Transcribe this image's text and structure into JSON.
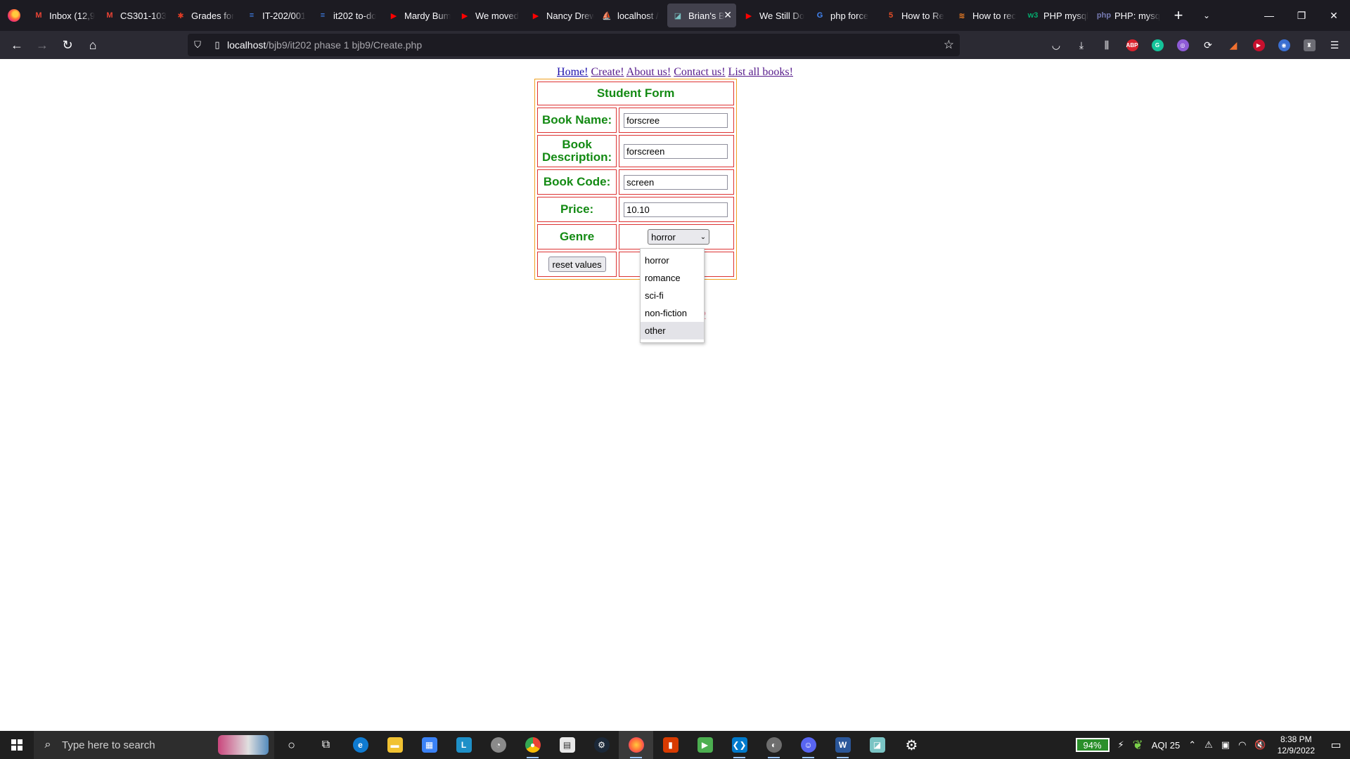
{
  "browser": {
    "tabs": [
      {
        "label": "Inbox (12,9",
        "icon": "gmail-icon",
        "glyph": "M",
        "color": "#ea4335"
      },
      {
        "label": "CS301-103",
        "icon": "gmail-icon",
        "glyph": "M",
        "color": "#ea4335"
      },
      {
        "label": "Grades for",
        "icon": "canvas-icon",
        "glyph": "✱",
        "color": "#e03b24"
      },
      {
        "label": "IT-202/001",
        "icon": "docs-icon",
        "glyph": "≡",
        "color": "#4285f4"
      },
      {
        "label": "it202 to-do",
        "icon": "docs-icon",
        "glyph": "≡",
        "color": "#4285f4"
      },
      {
        "label": "Mardy Bum",
        "icon": "youtube-icon",
        "glyph": "▶",
        "color": "#ff0000"
      },
      {
        "label": "We moved",
        "icon": "youtube-icon",
        "glyph": "▶",
        "color": "#ff0000"
      },
      {
        "label": "Nancy Drew",
        "icon": "youtube-icon",
        "glyph": "▶",
        "color": "#ff0000"
      },
      {
        "label": "localhost /",
        "icon": "phpmyadmin-icon",
        "glyph": "⛵",
        "color": "#f0a020"
      },
      {
        "label": "Brian's B",
        "icon": "page-icon",
        "glyph": "◪",
        "color": "#7ac4c4"
      },
      {
        "label": "We Still Do",
        "icon": "youtube-icon",
        "glyph": "▶",
        "color": "#ff0000"
      },
      {
        "label": "php force",
        "icon": "google-icon",
        "glyph": "G",
        "color": "#4285f4"
      },
      {
        "label": "How to Re",
        "icon": "html-icon",
        "glyph": "5",
        "color": "#e44d26"
      },
      {
        "label": "How to rec",
        "icon": "stackoverflow-icon",
        "glyph": "≋",
        "color": "#f48024"
      },
      {
        "label": "PHP mysql",
        "icon": "w3schools-icon",
        "glyph": "w3",
        "color": "#04aa6d"
      },
      {
        "label": "PHP: mysq",
        "icon": "php-icon",
        "glyph": "php",
        "color": "#777bb3"
      }
    ],
    "url_host": "localhost",
    "url_path": "/bjb9/it202 phase 1 bjb9/Create.php"
  },
  "page": {
    "nav": {
      "home": "Home!",
      "create": "Create!",
      "about": "About us!",
      "contact": "Contact us!",
      "list": "List all books!"
    },
    "form": {
      "title": "Student Form",
      "book_name_label": "Book Name:",
      "book_name_value": "forscree",
      "book_desc_label": "Book Description:",
      "book_desc_value": "forscreen",
      "book_code_label": "Book Code:",
      "book_code_value": "screen",
      "price_label": "Price:",
      "price_value": "10.10",
      "genre_label": "Genre",
      "genre_selected": "horror",
      "genre_options": [
        "horror",
        "romance",
        "sci-fi",
        "non-fiction",
        "other"
      ],
      "reset_label": "reset values"
    },
    "footer": "© Bri                e 2022",
    "footer_color": "#f4a5b5"
  },
  "taskbar": {
    "search_placeholder": "Type here to search",
    "battery": "94%",
    "aqi": "AQI 25",
    "time": "8:38 PM",
    "date": "12/9/2022"
  }
}
